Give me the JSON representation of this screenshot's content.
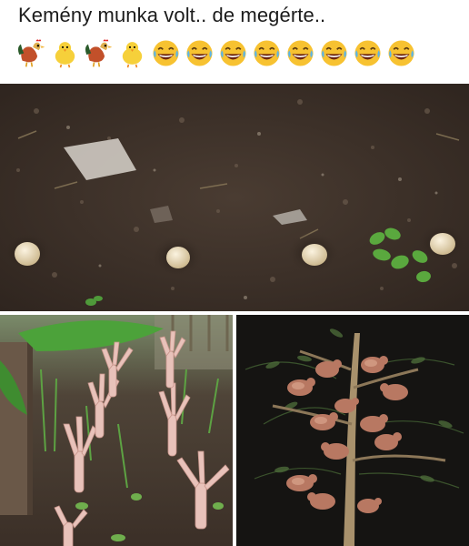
{
  "caption": {
    "text": "Kemény munka volt.. de megérte.."
  },
  "emojis": [
    "rooster-icon",
    "chick-icon",
    "rooster-icon",
    "chick-icon",
    "laughing-face-icon",
    "laughing-face-icon",
    "laughing-face-icon",
    "laughing-face-icon",
    "laughing-face-icon",
    "laughing-face-icon",
    "laughing-face-icon",
    "laughing-face-icon"
  ],
  "colors": {
    "soil": "#3a2e26",
    "soil_light": "#5a4a3e",
    "egg": "#e9dcc0",
    "leaf": "#4f9a3a",
    "chicken_feet": "#e6b9b0",
    "night": "#141311",
    "hen": "#b0705a"
  }
}
